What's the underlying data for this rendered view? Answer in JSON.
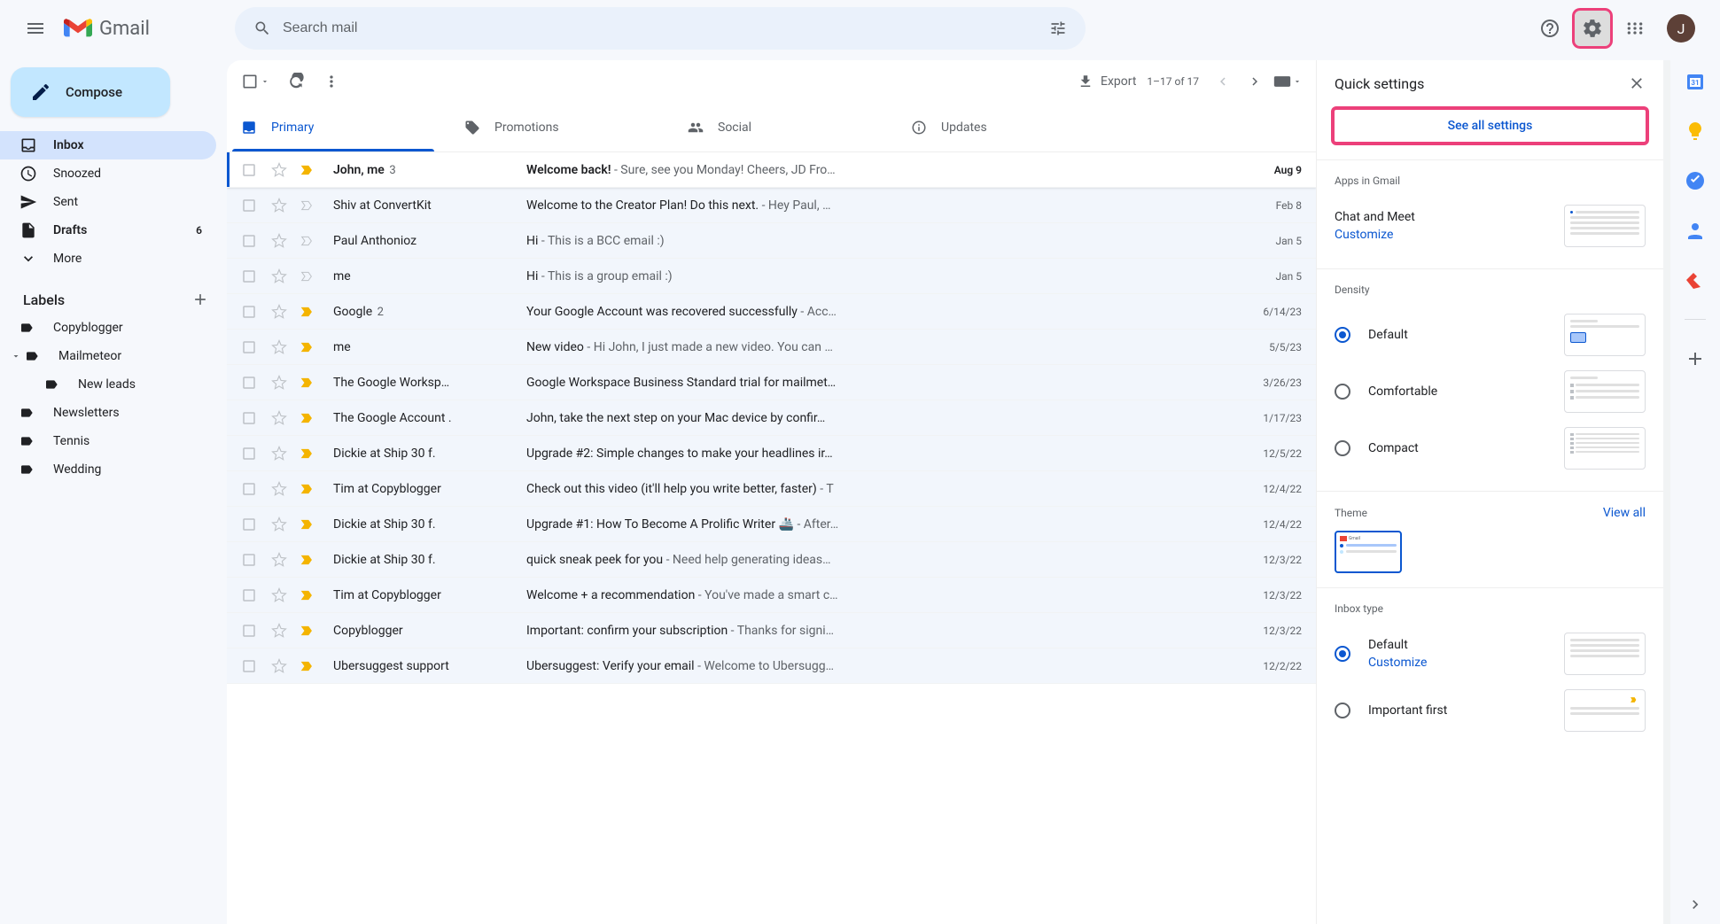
{
  "header": {
    "app_name": "Gmail",
    "search_placeholder": "Search mail",
    "avatar_initial": "J"
  },
  "sidebar": {
    "compose": "Compose",
    "nav": [
      {
        "label": "Inbox",
        "active": true
      },
      {
        "label": "Snoozed"
      },
      {
        "label": "Sent"
      },
      {
        "label": "Drafts",
        "count": "6",
        "bold": true
      },
      {
        "label": "More"
      }
    ],
    "labels_header": "Labels",
    "labels": [
      {
        "label": "Copyblogger"
      },
      {
        "label": "Mailmeteor",
        "expandable": true
      },
      {
        "label": "New leads",
        "sub": true
      },
      {
        "label": "Newsletters"
      },
      {
        "label": "Tennis"
      },
      {
        "label": "Wedding"
      }
    ]
  },
  "toolbar": {
    "export": "Export",
    "page_range": "1–17 of 17"
  },
  "tabs": [
    {
      "label": "Primary",
      "active": true
    },
    {
      "label": "Promotions"
    },
    {
      "label": "Social"
    },
    {
      "label": "Updates"
    }
  ],
  "emails": [
    {
      "sender": "John, me",
      "count": "3",
      "subject": "Welcome back!",
      "preview": " - Sure, see you Monday! Cheers, JD Fro…",
      "date": "Aug 9",
      "unread": true,
      "important": true
    },
    {
      "sender": "Shiv at ConvertKit",
      "subject": "Welcome to the Creator Plan! Do this next.",
      "preview": " - Hey Paul, …",
      "date": "Feb 8",
      "important": false
    },
    {
      "sender": "Paul Anthonioz",
      "subject": "Hi",
      "preview": " - This is a BCC email :)",
      "date": "Jan 5",
      "important": false
    },
    {
      "sender": "me",
      "subject": "Hi",
      "preview": " - This is a group email :)",
      "date": "Jan 5",
      "important": false
    },
    {
      "sender": "Google",
      "count": "2",
      "subject": "Your Google Account was recovered successfully",
      "preview": " - Acc…",
      "date": "6/14/23",
      "important": true
    },
    {
      "sender": "me",
      "subject": "New video",
      "preview": " - Hi John, I just made a new video. You can …",
      "date": "5/5/23",
      "important": true
    },
    {
      "sender": "The Google Worksp…",
      "subject": "Google Workspace Business Standard trial for mailmet…",
      "preview": "",
      "date": "3/26/23",
      "important": true
    },
    {
      "sender": "The Google Account .",
      "subject": "John, take the next step on your Mac device by confir…",
      "preview": "",
      "date": "1/17/23",
      "important": true
    },
    {
      "sender": "Dickie at Ship 30 f.",
      "subject": "Upgrade #2: Simple changes to make your headlines ir…",
      "preview": "",
      "date": "12/5/22",
      "important": true
    },
    {
      "sender": "Tim at Copyblogger",
      "subject": "Check out this video (it'll help you write better, faster)",
      "preview": " - T",
      "date": "12/4/22",
      "important": true
    },
    {
      "sender": "Dickie at Ship 30 f.",
      "subject": "Upgrade #1: How To Become A Prolific Writer 🚢",
      "preview": " - After…",
      "date": "12/4/22",
      "important": true
    },
    {
      "sender": "Dickie at Ship 30 f.",
      "subject": "quick sneak peek for you",
      "preview": " - Need help generating ideas…",
      "date": "12/3/22",
      "important": true
    },
    {
      "sender": "Tim at Copyblogger",
      "subject": "Welcome + a recommendation",
      "preview": " - You've made a smart c…",
      "date": "12/3/22",
      "important": true
    },
    {
      "sender": "Copyblogger",
      "subject": "Important: confirm your subscription",
      "preview": " - Thanks for signi…",
      "date": "12/3/22",
      "important": true
    },
    {
      "sender": "Ubersuggest support",
      "subject": "Ubersuggest: Verify your email",
      "preview": " - Welcome to Ubersugg…",
      "date": "12/2/22",
      "important": true
    }
  ],
  "quick_settings": {
    "title": "Quick settings",
    "see_all": "See all settings",
    "apps_title": "Apps in Gmail",
    "chat_meet": "Chat and Meet",
    "customize": "Customize",
    "density_title": "Density",
    "density_options": [
      "Default",
      "Comfortable",
      "Compact"
    ],
    "theme_title": "Theme",
    "view_all": "View all",
    "inbox_type_title": "Inbox type",
    "inbox_default": "Default",
    "inbox_important": "Important first"
  }
}
